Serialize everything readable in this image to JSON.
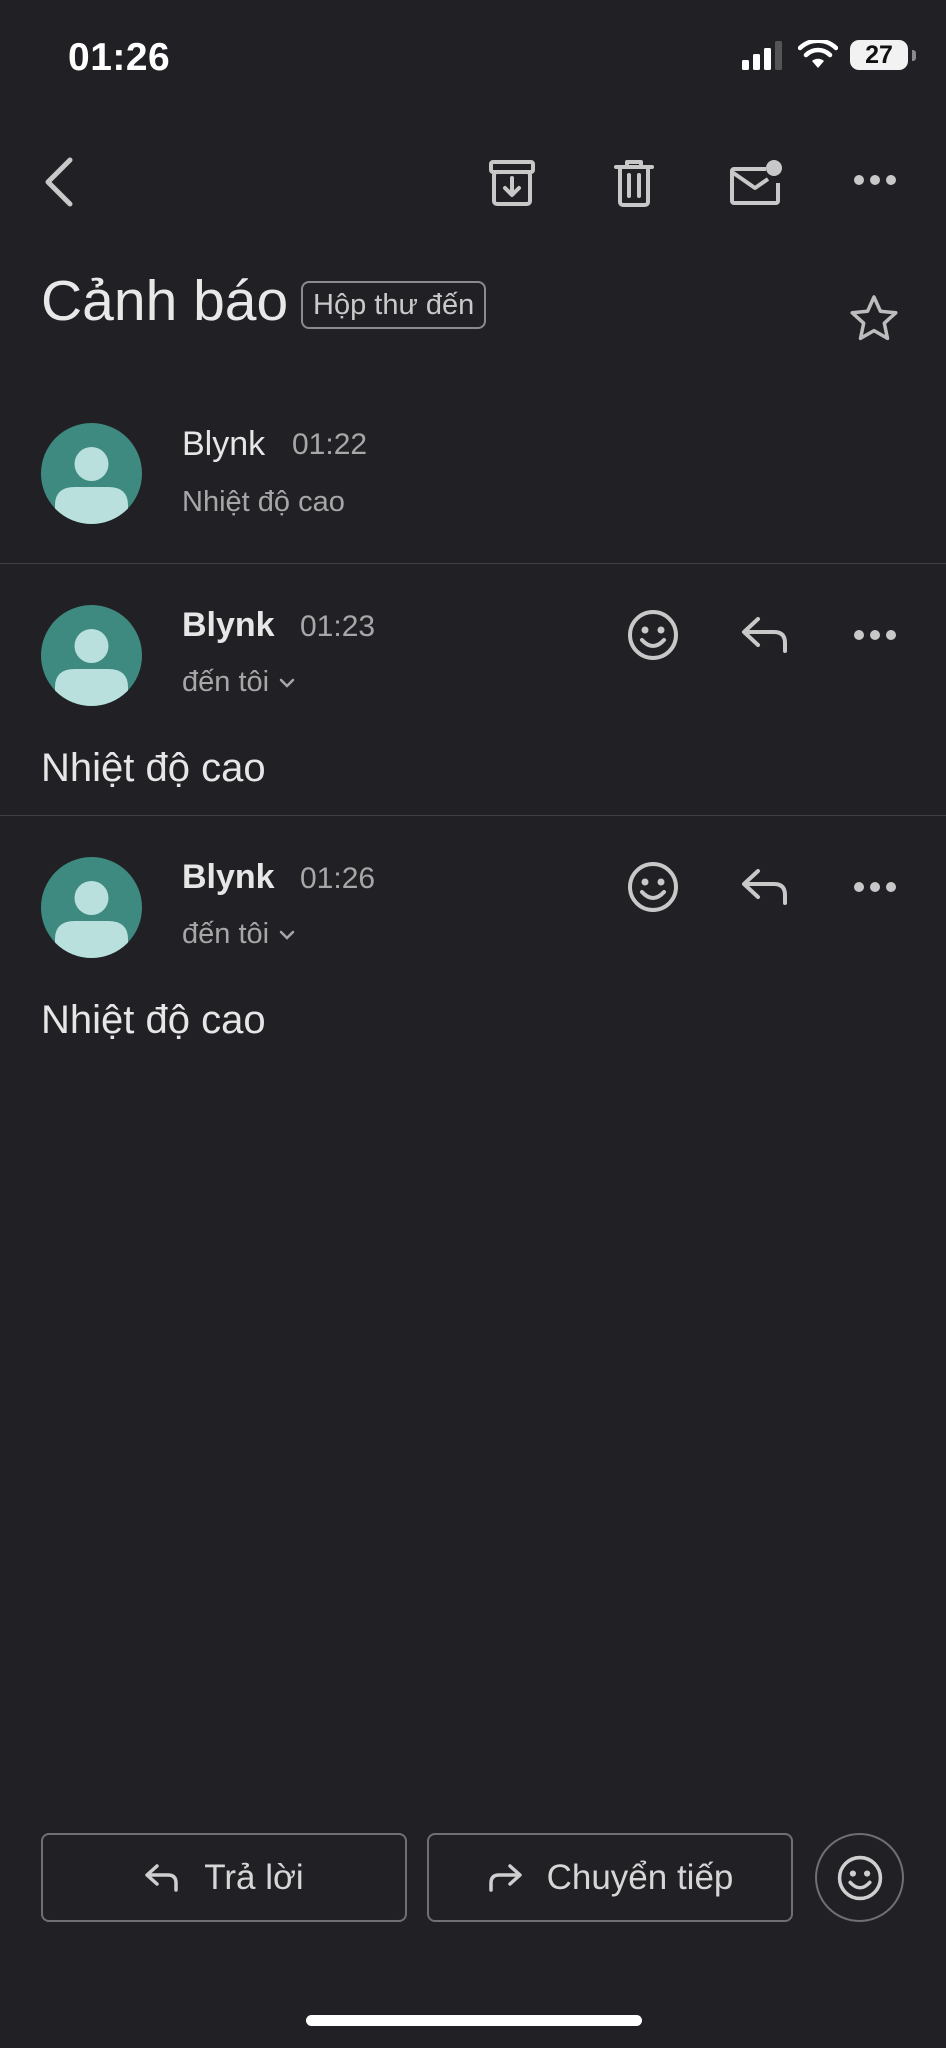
{
  "status_bar": {
    "time": "01:26",
    "battery": "27"
  },
  "toolbar": {
    "icons": [
      "back-icon",
      "archive-icon",
      "delete-icon",
      "mark-unread-icon",
      "more-icon"
    ]
  },
  "thread": {
    "subject": "Cảnh báo",
    "label": "Hộp thư đến"
  },
  "messages": [
    {
      "sender": "Blynk",
      "time": "01:22",
      "snippet": "Nhiệt độ cao"
    },
    {
      "sender": "Blynk",
      "time": "01:23",
      "recipient": "đến tôi",
      "body": "Nhiệt độ cao"
    },
    {
      "sender": "Blynk",
      "time": "01:26",
      "recipient": "đến tôi",
      "body": "Nhiệt độ cao"
    }
  ],
  "actions": {
    "reply": "Trả lời",
    "forward": "Chuyển tiếp"
  },
  "colors": {
    "background": "#212125",
    "avatar": "#3f8a80",
    "avatar_figure": "#b9e0dc"
  }
}
